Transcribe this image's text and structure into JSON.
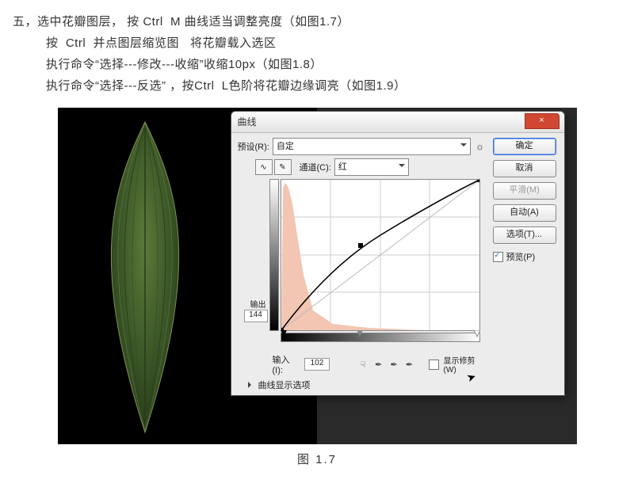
{
  "instructions": {
    "line1": "五，选中花瓣图层， 按 Ctrl  M 曲线适当调整亮度（如图1.7）",
    "line2": "按  Ctrl  并点图层缩览图   将花瓣载入选区",
    "line3": "执行命令“选择---修改---收缩”收缩10px（如图1.8）",
    "line4": "执行命令“选择---反选” ，按Ctrl  L色阶将花瓣边缘调亮（如图1.9）"
  },
  "dialog": {
    "title": "曲线",
    "close": "×",
    "preset_label": "预设(R):",
    "preset_value": "自定",
    "channel_label": "通道(C):",
    "channel_value": "红",
    "output_label": "输出(O):",
    "output_value": "144",
    "input_label": "输入(I):",
    "input_value": "102",
    "show_clip_label": "显示修剪(W)",
    "curve_options": "曲线显示选项",
    "buttons": {
      "ok": "确定",
      "cancel": "取消",
      "smooth": "平滑(M)",
      "auto": "自动(A)",
      "options": "选项(T)..."
    },
    "preview_label": "预览(P)"
  },
  "caption": "图  1.7"
}
